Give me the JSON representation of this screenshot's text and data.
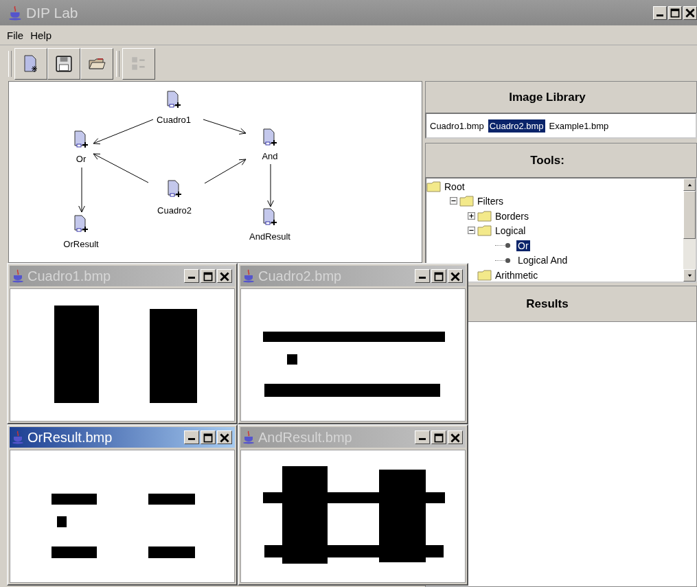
{
  "window": {
    "title": "DIP Lab"
  },
  "menu": [
    "File",
    "Help"
  ],
  "toolbar": [
    {
      "kind": "new",
      "disabled": false
    },
    {
      "kind": "save",
      "disabled": false
    },
    {
      "kind": "open",
      "disabled": false
    },
    {
      "kind": "checklist",
      "disabled": true
    }
  ],
  "graph": {
    "nodes": [
      {
        "label": "Cuadro1"
      },
      {
        "label": "Or"
      },
      {
        "label": "And"
      },
      {
        "label": "Cuadro2"
      },
      {
        "label": "OrResult"
      },
      {
        "label": "AndResult"
      }
    ]
  },
  "image_library": {
    "title": "Image Library",
    "items": [
      {
        "label": "Cuadro1.bmp",
        "selected": false
      },
      {
        "label": "Cuadro2.bmp",
        "selected": true
      },
      {
        "label": "Example1.bmp",
        "selected": false
      }
    ]
  },
  "tools": {
    "title": "Tools:",
    "tree": [
      {
        "label": "Root",
        "kind": "folder",
        "children": [
          {
            "label": "Filters",
            "kind": "folder",
            "expanded": true,
            "children": [
              {
                "label": "Borders",
                "kind": "folder",
                "expanded": false
              },
              {
                "label": "Logical",
                "kind": "folder",
                "expanded": true,
                "children": [
                  {
                    "label": "Or",
                    "kind": "leaf",
                    "selected": true
                  },
                  {
                    "label": "Logical And",
                    "kind": "leaf",
                    "selected": false
                  }
                ]
              },
              {
                "label": "Arithmetic",
                "kind": "folder"
              }
            ]
          }
        ]
      }
    ]
  },
  "results": {
    "title": "Results"
  },
  "frames": [
    {
      "title": "Cuadro1.bmp",
      "active": false
    },
    {
      "title": "Cuadro2.bmp",
      "active": false
    },
    {
      "title": "OrResult.bmp",
      "active": true
    },
    {
      "title": "AndResult.bmp",
      "active": false
    }
  ]
}
